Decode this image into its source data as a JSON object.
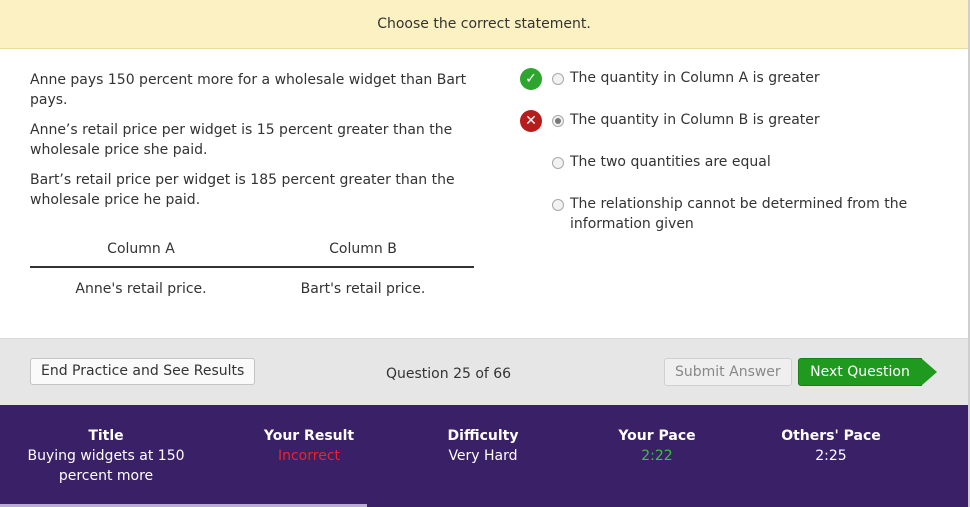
{
  "instruction": "Choose the correct statement.",
  "question": {
    "stem": [
      "Anne pays 150 percent more for a wholesale widget than Bart pays.",
      "Anne’s retail price per widget is 15 percent greater than the wholesale price she paid.",
      "Bart’s retail price per widget is 185 percent greater than the wholesale price he paid."
    ],
    "columns": {
      "a_header": "Column A",
      "b_header": "Column B",
      "a_value": "Anne's retail price.",
      "b_value": "Bart's retail price."
    }
  },
  "answers": [
    {
      "text": "The quantity in Column A is greater",
      "mark": "correct",
      "selected": false
    },
    {
      "text": "The quantity in Column B is greater",
      "mark": "wrong",
      "selected": true
    },
    {
      "text": "The two quantities are equal",
      "mark": "none",
      "selected": false
    },
    {
      "text": "The relationship cannot be determined from the information given",
      "mark": "none",
      "selected": false
    }
  ],
  "controls": {
    "end_label": "End Practice and See Results",
    "counter": "Question 25 of 66",
    "submit_label": "Submit Answer",
    "next_label": "Next Question"
  },
  "stats": {
    "title_label": "Title",
    "title_value": "Buying widgets at 150 percent more",
    "result_label": "Your Result",
    "result_value": "Incorrect",
    "difficulty_label": "Difficulty",
    "difficulty_value": "Very Hard",
    "pace_label": "Your Pace",
    "pace_value": "2:22",
    "others_label": "Others' Pace",
    "others_value": "2:25"
  },
  "progress": {
    "fraction": 0.379
  },
  "colors": {
    "correct": "#2ea52e",
    "wrong": "#b51c1c",
    "incorrect_text": "#e8262a",
    "pace_text": "#3fbf3f",
    "stats_bg": "#3a2066",
    "next_button": "#1f9a1f"
  }
}
